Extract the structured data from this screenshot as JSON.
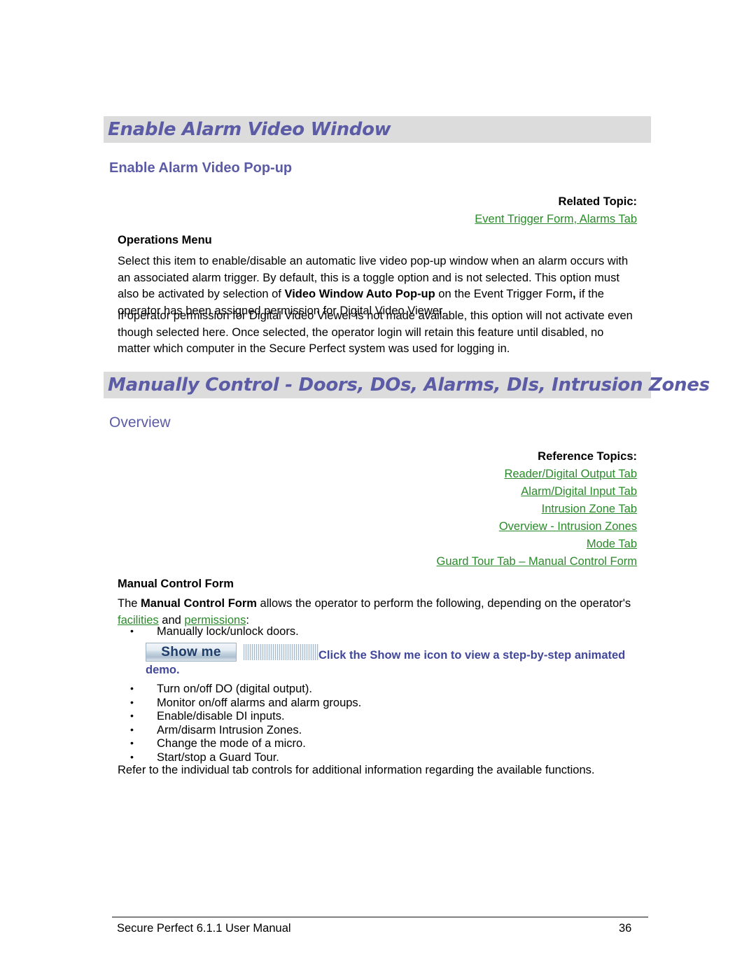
{
  "document": {
    "sections": [
      {
        "heading": "Enable Alarm Video Window",
        "subheading": "Enable Alarm Video Pop-up",
        "related": {
          "title": "Related Topic:",
          "links": [
            "Event Trigger Form, Alarms Tab"
          ]
        },
        "label": "Operations Menu",
        "paragraph1_a": "Select this item to enable/disable an automatic live video pop-up window when an alarm occurs with an associated alarm trigger. By default, this is a toggle option and is not selected. This option must also be activated by selection of ",
        "paragraph1_bold": "Video Window Auto Pop-up",
        "paragraph1_b": " on the Event Trigger Form",
        "paragraph1_bold2": ",",
        "paragraph1_c": " if the operator has been assigned permission for Digital Video Viewer.",
        "paragraph2": "If operator permission for Digital Video Viewer is not made available, this option will not activate even though selected here. Once selected, the operator login will retain this feature until disabled, no matter which computer in the Secure Perfect system was used for logging in."
      },
      {
        "heading": "Manually Control - Doors, DOs, Alarms, DIs, Intrusion Zones",
        "subheading": "Overview",
        "related": {
          "title": "Reference Topics:",
          "links": [
            "Reader/Digital Output Tab",
            "Alarm/Digital Input Tab",
            "Intrusion Zone Tab",
            "Overview - Intrusion Zones",
            "Mode Tab",
            "Guard Tour Tab – Manual Control Form"
          ]
        },
        "label": "Manual Control Form",
        "paragraph1_a": "The ",
        "paragraph1_bold": "Manual Control Form",
        "paragraph1_b": " allows the operator to perform the following, depending on the operator's ",
        "paragraph1_link1": "facilities",
        "paragraph1_c": " and ",
        "paragraph1_link2": "permissions",
        "paragraph1_d": ":",
        "bullets_first": [
          "Manually lock/unlock doors."
        ],
        "showme": {
          "button_label": "Show me",
          "caption_line1": "Click the Show me icon to view a step-by-step animated",
          "caption_line2": "demo."
        },
        "bullets_rest": [
          "Turn on/off DO (digital output).",
          "Monitor on/off alarms and alarm groups.",
          "Enable/disable DI inputs.",
          "Arm/disarm Intrusion Zones.",
          "Change the mode of a micro.",
          "Start/stop a Guard Tour."
        ],
        "closing": "Refer to the individual tab controls for additional information regarding the available functions."
      }
    ]
  },
  "footer": {
    "left": "Secure Perfect 6.1.1 User Manual",
    "page_number": "36"
  },
  "colors": {
    "heading_text": "#5b5ba6",
    "heading_band": "#dcdcdc",
    "link_green": "#2b8a2b",
    "showme_caption": "#41479b"
  }
}
